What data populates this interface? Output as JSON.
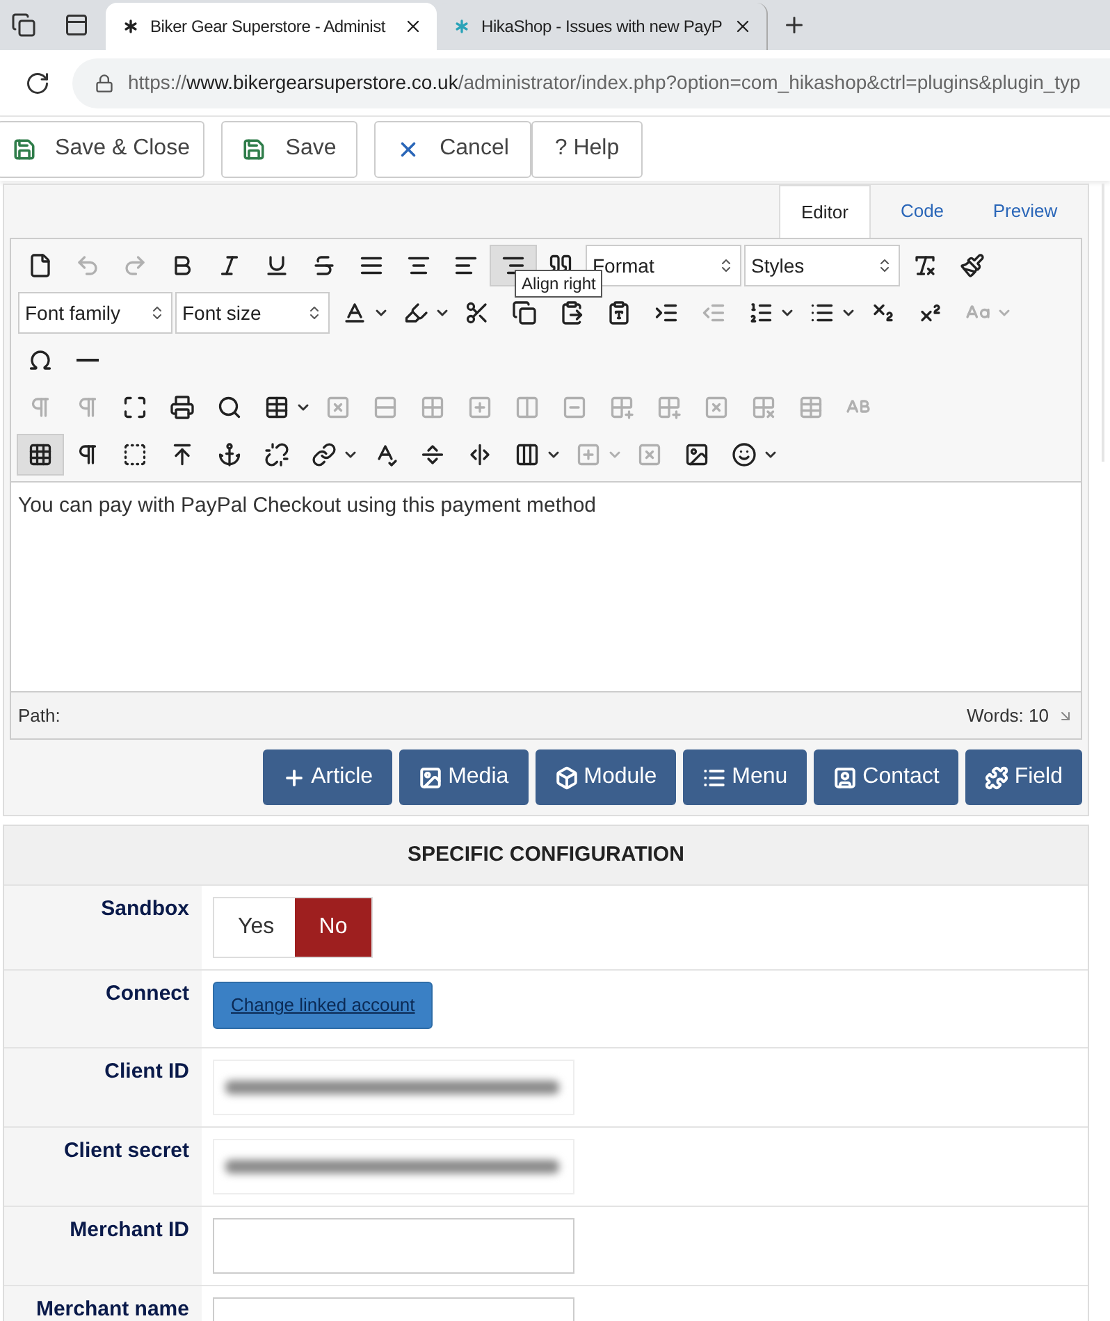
{
  "browser": {
    "tabs": [
      {
        "title": "Biker Gear Superstore - Administ",
        "selected": true
      },
      {
        "title": "HikaShop - Issues with new PayP",
        "selected": false
      }
    ],
    "url": {
      "scheme": "https://",
      "host": "www.bikergearsuperstore.co.uk",
      "path": "/administrator/index.php?option=com_hikashop&ctrl=plugins&plugin_typ"
    }
  },
  "actions": [
    {
      "kind": "save-close",
      "label": "Save & Close"
    },
    {
      "kind": "save",
      "label": "Save"
    },
    {
      "kind": "cancel",
      "label": "Cancel"
    },
    {
      "kind": "help",
      "label": "? Help"
    }
  ],
  "editor": {
    "tabs": [
      {
        "label": "Editor",
        "selected": true
      },
      {
        "label": "Code",
        "selected": false
      },
      {
        "label": "Preview",
        "selected": false
      }
    ],
    "toolbar_rows": [
      [
        {
          "kind": "button",
          "disabled": false,
          "active": false,
          "dropdown": false
        },
        {
          "kind": "button",
          "disabled": true,
          "active": false,
          "dropdown": false
        },
        {
          "kind": "button",
          "disabled": true,
          "active": false,
          "dropdown": false
        },
        {
          "kind": "button",
          "disabled": false,
          "active": false,
          "dropdown": false
        },
        {
          "kind": "button",
          "disabled": false,
          "active": false,
          "dropdown": false
        },
        {
          "kind": "button",
          "disabled": false,
          "active": false,
          "dropdown": false
        },
        {
          "kind": "button",
          "disabled": false,
          "active": false,
          "dropdown": false
        },
        {
          "kind": "button",
          "disabled": false,
          "active": false,
          "dropdown": false
        },
        {
          "kind": "button",
          "disabled": false,
          "active": false,
          "dropdown": false
        },
        {
          "kind": "button",
          "disabled": false,
          "active": false,
          "dropdown": false
        },
        {
          "kind": "button",
          "disabled": false,
          "active": true,
          "dropdown": false
        },
        {
          "kind": "button",
          "disabled": false,
          "active": false,
          "dropdown": false
        },
        {
          "kind": "select",
          "label": "Format"
        },
        {
          "kind": "select",
          "label": "Styles"
        },
        {
          "kind": "button",
          "disabled": false,
          "active": false,
          "dropdown": false
        },
        {
          "kind": "button",
          "disabled": false,
          "active": false,
          "dropdown": false
        }
      ],
      [
        {
          "kind": "select",
          "label": "Font family"
        },
        {
          "kind": "select",
          "label": "Font size"
        },
        {
          "kind": "button",
          "disabled": false,
          "active": false,
          "dropdown": true
        },
        {
          "kind": "button",
          "disabled": false,
          "active": false,
          "dropdown": true
        },
        {
          "kind": "button",
          "disabled": false,
          "active": false,
          "dropdown": false
        },
        {
          "kind": "button",
          "disabled": false,
          "active": false,
          "dropdown": false
        },
        {
          "kind": "button",
          "disabled": false,
          "active": false,
          "dropdown": false
        },
        {
          "kind": "button",
          "disabled": false,
          "active": false,
          "dropdown": false
        },
        {
          "kind": "button",
          "disabled": false,
          "active": false,
          "dropdown": false
        },
        {
          "kind": "button",
          "disabled": true,
          "active": false,
          "dropdown": false
        },
        {
          "kind": "button",
          "disabled": false,
          "active": false,
          "dropdown": true
        },
        {
          "kind": "button",
          "disabled": false,
          "active": false,
          "dropdown": true
        },
        {
          "kind": "button",
          "disabled": false,
          "active": false,
          "dropdown": false
        },
        {
          "kind": "button",
          "disabled": false,
          "active": false,
          "dropdown": false
        },
        {
          "kind": "button",
          "disabled": true,
          "active": false,
          "dropdown": true
        }
      ],
      [
        {
          "kind": "button",
          "disabled": false,
          "active": false,
          "dropdown": false
        },
        {
          "kind": "button",
          "disabled": false,
          "active": false,
          "dropdown": false
        }
      ],
      [
        {
          "kind": "button",
          "disabled": true,
          "active": false,
          "dropdown": false
        },
        {
          "kind": "button",
          "disabled": true,
          "active": false,
          "dropdown": false
        },
        {
          "kind": "button",
          "disabled": false,
          "active": false,
          "dropdown": false
        },
        {
          "kind": "button",
          "disabled": false,
          "active": false,
          "dropdown": false
        },
        {
          "kind": "button",
          "disabled": false,
          "active": false,
          "dropdown": false
        },
        {
          "kind": "button",
          "disabled": false,
          "active": false,
          "dropdown": true
        },
        {
          "kind": "button",
          "disabled": true,
          "active": false,
          "dropdown": false
        },
        {
          "kind": "button",
          "disabled": true,
          "active": false,
          "dropdown": false
        },
        {
          "kind": "button",
          "disabled": true,
          "active": false,
          "dropdown": false
        },
        {
          "kind": "button",
          "disabled": true,
          "active": false,
          "dropdown": false
        },
        {
          "kind": "button",
          "disabled": true,
          "active": false,
          "dropdown": false
        },
        {
          "kind": "button",
          "disabled": true,
          "active": false,
          "dropdown": false
        },
        {
          "kind": "button",
          "disabled": true,
          "active": false,
          "dropdown": false
        },
        {
          "kind": "button",
          "disabled": true,
          "active": false,
          "dropdown": false
        },
        {
          "kind": "button",
          "disabled": true,
          "active": false,
          "dropdown": false
        },
        {
          "kind": "button",
          "disabled": true,
          "active": false,
          "dropdown": false
        },
        {
          "kind": "button",
          "disabled": true,
          "active": false,
          "dropdown": false
        },
        {
          "kind": "button",
          "disabled": true,
          "active": false,
          "dropdown": false
        }
      ],
      [
        {
          "kind": "button",
          "disabled": false,
          "active": true,
          "dropdown": false
        },
        {
          "kind": "button",
          "disabled": false,
          "active": false,
          "dropdown": false
        },
        {
          "kind": "button",
          "disabled": false,
          "active": false,
          "dropdown": false
        },
        {
          "kind": "button",
          "disabled": false,
          "active": false,
          "dropdown": false
        },
        {
          "kind": "button",
          "disabled": false,
          "active": false,
          "dropdown": false
        },
        {
          "kind": "button",
          "disabled": false,
          "active": false,
          "dropdown": false
        },
        {
          "kind": "button",
          "disabled": false,
          "active": false,
          "dropdown": true
        },
        {
          "kind": "button",
          "disabled": false,
          "active": false,
          "dropdown": false
        },
        {
          "kind": "button",
          "disabled": false,
          "active": false,
          "dropdown": false
        },
        {
          "kind": "button",
          "disabled": false,
          "active": false,
          "dropdown": false
        },
        {
          "kind": "button",
          "disabled": false,
          "active": false,
          "dropdown": true
        },
        {
          "kind": "button",
          "disabled": true,
          "active": false,
          "dropdown": true
        },
        {
          "kind": "button",
          "disabled": true,
          "active": false,
          "dropdown": false
        },
        {
          "kind": "button",
          "disabled": false,
          "active": false,
          "dropdown": false
        },
        {
          "kind": "button",
          "disabled": false,
          "active": false,
          "dropdown": true
        }
      ]
    ],
    "tooltip": "Align right",
    "content": "You can pay with PayPal Checkout using this payment method",
    "path_label": "Path:",
    "word_count": "Words: 10",
    "insert_buttons": [
      {
        "kind": "article",
        "label": "Article"
      },
      {
        "kind": "media",
        "label": "Media"
      },
      {
        "kind": "module",
        "label": "Module"
      },
      {
        "kind": "menu",
        "label": "Menu"
      },
      {
        "kind": "contact",
        "label": "Contact"
      },
      {
        "kind": "field",
        "label": "Field"
      }
    ]
  },
  "config": {
    "title": "SPECIFIC CONFIGURATION",
    "rows": [
      {
        "label": "Sandbox",
        "kind": "toggle",
        "options": [
          {
            "label": "Yes",
            "selected": false
          },
          {
            "label": "No",
            "selected": true
          }
        ]
      },
      {
        "label": "Connect",
        "kind": "button",
        "button": "Change linked account"
      },
      {
        "label": "Client ID",
        "kind": "redacted"
      },
      {
        "label": "Client secret",
        "kind": "redacted"
      },
      {
        "label": "Merchant ID",
        "kind": "field"
      },
      {
        "label": "Merchant name",
        "kind": "field"
      }
    ]
  }
}
